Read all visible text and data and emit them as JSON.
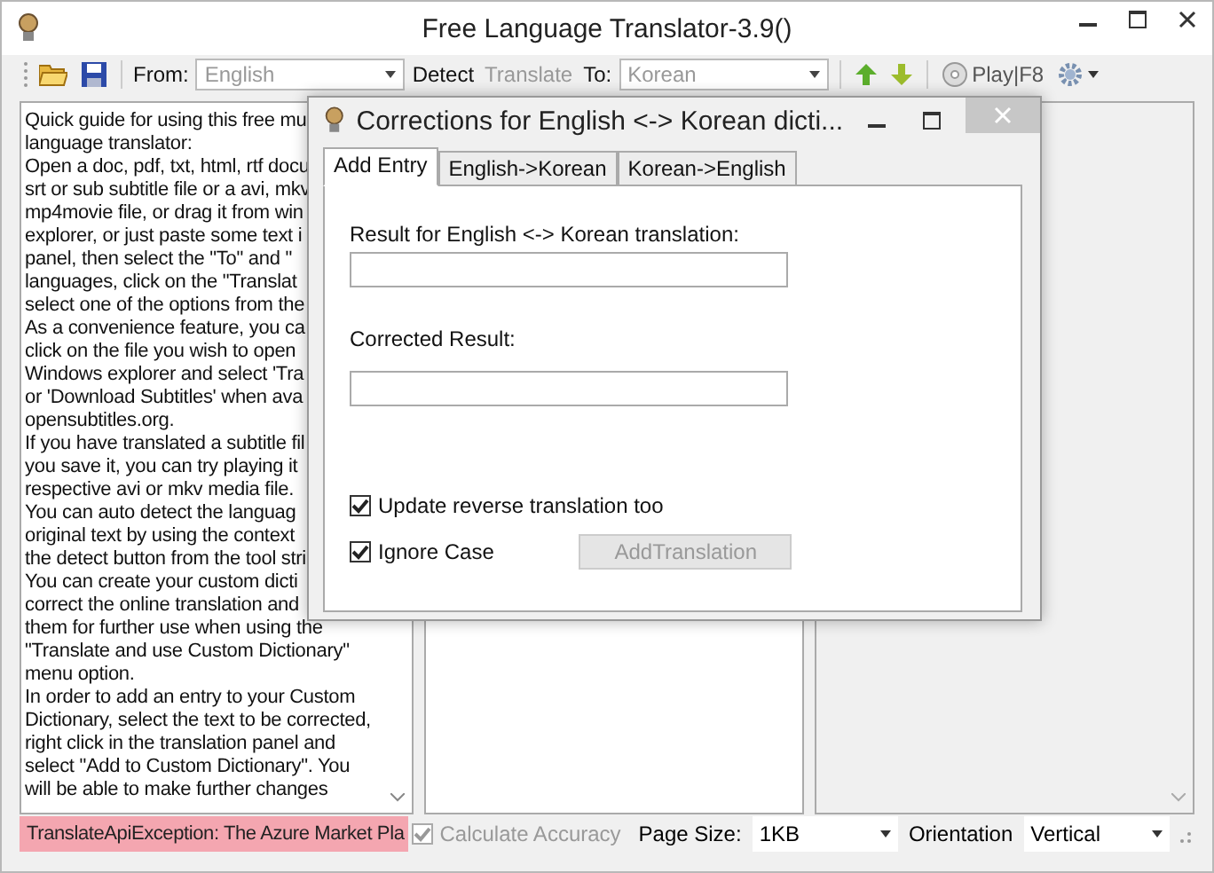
{
  "window": {
    "title": "Free Language Translator-3.9()"
  },
  "toolbar": {
    "from_label": "From:",
    "from": {
      "value": "English",
      "disabled": true
    },
    "detect": "Detect",
    "translate": {
      "label": "Translate",
      "disabled": true
    },
    "to_label": "To:",
    "to": {
      "value": "Korean",
      "disabled": true
    },
    "play": "Play|F8"
  },
  "guide_text": [
    "Quick guide for using this free mu",
    "language translator:",
    "Open a doc, pdf, txt, html, rtf docu",
    "srt or sub subtitle file or a avi, mkv",
    "mp4movie file, or drag it from win",
    "explorer, or just paste some text i",
    "panel, then select the \"To\" and \"",
    "languages, click on the \"Translat",
    "select one of the options from the",
    "As a convenience feature, you ca",
    "click on the file you wish to open",
    "Windows explorer and select 'Tra",
    "or 'Download Subtitles' when ava",
    "opensubtitles.org.",
    "If you have translated a subtitle fil",
    "you save it, you can try playing it",
    "respective avi or mkv media file.",
    "You can auto detect the languag",
    "original text by using the context",
    "the detect button from the tool stri",
    "You can create your custom dicti",
    "correct the online translation and",
    "them for further use when using the",
    "\"Translate and use Custom Dictionary\"",
    "menu option.",
    "In order to add an entry to your Custom",
    "Dictionary, select the text to be corrected,",
    "right click in the translation panel and",
    "select \"Add to Custom Dictionary\". You",
    "will be able to make further changes"
  ],
  "dialog": {
    "title": "Corrections for English <-> Korean dicti...",
    "tabs": [
      {
        "label": "Add Entry",
        "selected": true
      },
      {
        "label": "English->Korean",
        "selected": false
      },
      {
        "label": "Korean->English",
        "selected": false
      }
    ],
    "result_label": "Result for English <-> Korean translation:",
    "corrected_label": "Corrected Result:",
    "options": [
      {
        "label": "Update reverse translation too",
        "checked": true
      },
      {
        "label": "Ignore Case",
        "checked": true
      }
    ],
    "add_button": {
      "label": "AddTranslation",
      "disabled": true
    }
  },
  "status_bar": {
    "error": "TranslateApiException: The Azure Market Pla",
    "calculate_accuracy": {
      "label": "Calculate Accuracy",
      "checked": true,
      "disabled": true
    },
    "page_size_label": "Page Size:",
    "page_size": "1KB",
    "orientation_label": "Orientation",
    "orientation": "Vertical"
  }
}
